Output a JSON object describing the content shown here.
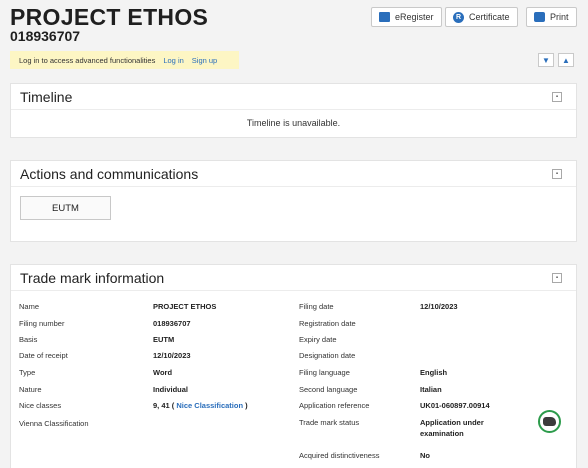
{
  "header": {
    "title": "PROJECT ETHOS",
    "number": "018936707"
  },
  "toolbar": {
    "eregister": "eRegister",
    "certificate": "Certificate",
    "print": "Print"
  },
  "notice": {
    "text": "Log in to access advanced functionalities",
    "login": "Log in",
    "signup": "Sign up"
  },
  "timeline": {
    "title": "Timeline",
    "message": "Timeline is unavailable."
  },
  "actions": {
    "title": "Actions and communications",
    "button": "EUTM"
  },
  "tmi": {
    "title": "Trade mark information",
    "left": [
      {
        "label": "Name",
        "value": "PROJECT ETHOS"
      },
      {
        "label": "Filing number",
        "value": "018936707"
      },
      {
        "label": "Basis",
        "value": "EUTM"
      },
      {
        "label": "Date of receipt",
        "value": "12/10/2023"
      },
      {
        "label": "Type",
        "value": "Word"
      },
      {
        "label": "Nature",
        "value": "Individual"
      },
      {
        "label": "Nice classes",
        "value": "9, 41 (",
        "link": "Nice Classification",
        "tail": ")"
      },
      {
        "label": "Vienna Classification",
        "value": ""
      }
    ],
    "right": [
      {
        "label": "Filing date",
        "value": "12/10/2023"
      },
      {
        "label": "Registration date",
        "value": ""
      },
      {
        "label": "Expiry date",
        "value": ""
      },
      {
        "label": "Designation date",
        "value": ""
      },
      {
        "label": "Filing language",
        "value": "English"
      },
      {
        "label": "Second language",
        "value": "Italian"
      },
      {
        "label": "Application reference",
        "value": "UK01-060897.00914"
      },
      {
        "label": "Trade mark status",
        "value": "Application under",
        "value2": "examination"
      },
      {
        "label": "Acquired distinctiveness",
        "value": "No"
      }
    ]
  }
}
